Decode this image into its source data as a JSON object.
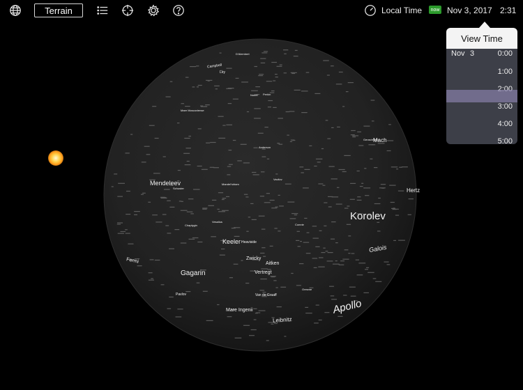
{
  "toolbar": {
    "globe_icon": "globe-icon",
    "terrain_label": "Terrain",
    "list_icon": "list-icon",
    "crosshair_icon": "crosshair-icon",
    "settings_icon": "gear-icon",
    "help_icon": "question-icon",
    "clock_icon": "clock-icon",
    "local_time_label": "Local Time",
    "now_badge": "now",
    "date": "Nov  3, 2017",
    "time": "2:31"
  },
  "view_time": {
    "title": "View Time",
    "date_month": "Nov",
    "date_day": "3",
    "times": [
      "0:00",
      "1:00",
      "2:00",
      "3:00",
      "4:00",
      "5:00"
    ],
    "selected_index": 3
  },
  "moon_labels": {
    "korolev": "Korolev",
    "apollo": "Apollo",
    "mendeleev": "Mendeleev",
    "gagarin": "Gagarin",
    "keeler": "Keeler",
    "heaviside": "Heaviside",
    "zwicky": "Zwicky",
    "aitken": "Aitken",
    "vertregt": "Vertregt",
    "mare_ingenii": "Mare Ingenii",
    "leibnitz": "Leibnitz",
    "galois": "Galois",
    "fermi": "Fermi",
    "mach": "Mach",
    "hertzsprung": "Hertz",
    "van_de_graaff": "Van de Graaff",
    "pavlov": "Pavlov",
    "chaplygin": "Chaplygin",
    "mandelshtam": "Mandel'shtam",
    "campbell": "Campbell",
    "dalembert": "D'Alembert",
    "ley": "Ley",
    "mare_moscoviense": "Mare Moscoviense",
    "andersson": "Anderson",
    "vavilov": "Vavilov",
    "tsiolkovskiy": "Tsiolkovskiy",
    "schuster": "Schuster",
    "vesalius": "Vesalius",
    "nobel": "Nobel",
    "comrie": "Comrie",
    "perkin": "Perkin",
    "oresme": "Oresme",
    "gerasimovich": "Gerasimovich"
  }
}
